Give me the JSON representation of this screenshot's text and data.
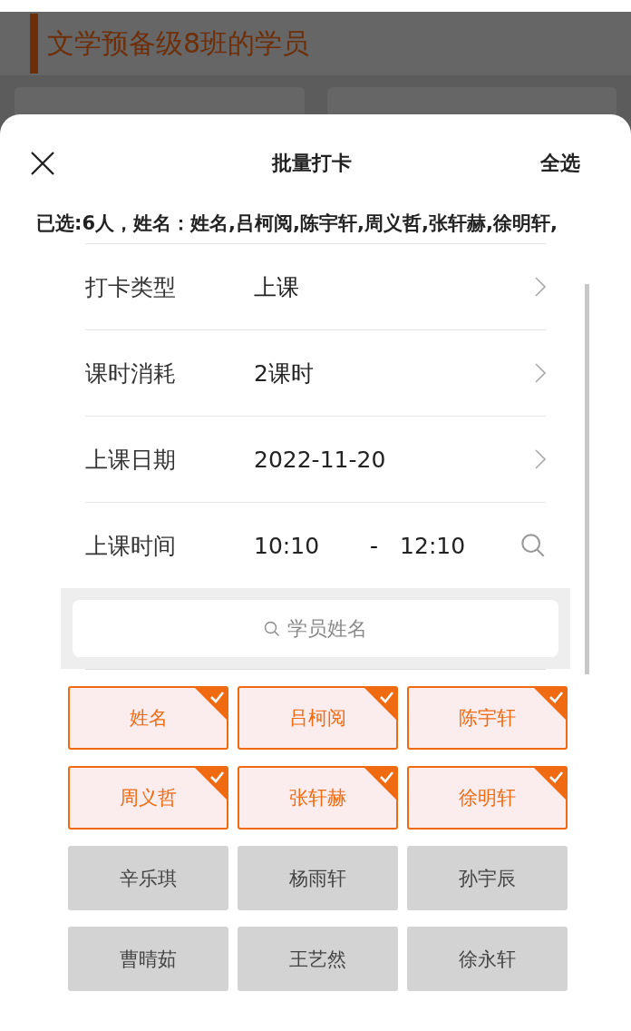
{
  "background": {
    "title": "文学预备级8班的学员"
  },
  "sheet": {
    "title": "批量打卡",
    "action": "全选",
    "summary": "已选:6人，姓名：姓名,吕柯阅,陈宇轩,周义哲,张轩赫,徐明轩,"
  },
  "form": [
    {
      "kind": "picker",
      "label": "打卡类型",
      "value": "上课"
    },
    {
      "kind": "picker",
      "label": "课时消耗",
      "value": "2课时"
    },
    {
      "kind": "picker",
      "label": "上课日期",
      "value": "2022-11-20"
    },
    {
      "kind": "time",
      "label": "上课时间",
      "start": "10:10",
      "separator": "-",
      "end": "12:10"
    }
  ],
  "search": {
    "placeholder": "学员姓名"
  },
  "students": [
    {
      "name": "姓名",
      "selected": true
    },
    {
      "name": "吕柯阅",
      "selected": true
    },
    {
      "name": "陈宇轩",
      "selected": true
    },
    {
      "name": "周义哲",
      "selected": true
    },
    {
      "name": "张轩赫",
      "selected": true
    },
    {
      "name": "徐明轩",
      "selected": true
    },
    {
      "name": "辛乐琪",
      "selected": false
    },
    {
      "name": "杨雨轩",
      "selected": false
    },
    {
      "name": "孙宇辰",
      "selected": false
    },
    {
      "name": "曹晴茹",
      "selected": false
    },
    {
      "name": "王艺然",
      "selected": false
    },
    {
      "name": "徐永轩",
      "selected": false
    }
  ]
}
